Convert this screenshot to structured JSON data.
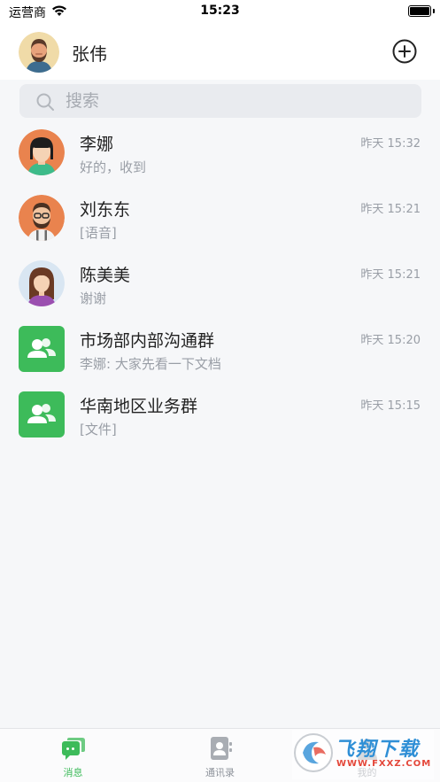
{
  "status_bar": {
    "carrier": "运营商",
    "time": "15:23"
  },
  "header": {
    "user_name": "张伟"
  },
  "search": {
    "placeholder": "搜索"
  },
  "conversations": [
    {
      "name": "李娜",
      "preview": "好的，收到",
      "time": "昨天 15:32"
    },
    {
      "name": "刘东东",
      "preview": "[语音]",
      "time": "昨天 15:21"
    },
    {
      "name": "陈美美",
      "preview": "谢谢",
      "time": "昨天 15:21"
    },
    {
      "name": "市场部内部沟通群",
      "preview": "李娜: 大家先看一下文档",
      "time": "昨天 15:20"
    },
    {
      "name": "华南地区业务群",
      "preview": "[文件]",
      "time": "昨天 15:15"
    }
  ],
  "tabs": [
    {
      "label": "消息",
      "icon": "chat-icon",
      "active": true
    },
    {
      "label": "通讯录",
      "icon": "contacts-icon",
      "active": false
    },
    {
      "label": "我的",
      "icon": "profile-icon",
      "active": false
    }
  ],
  "watermark": {
    "text": "飞翔下载",
    "url_text": "WWW.FXXZ.COM"
  },
  "colors": {
    "accent": "#3dbb5a",
    "background": "#f6f7f9",
    "secondary_text": "#999ea6"
  }
}
